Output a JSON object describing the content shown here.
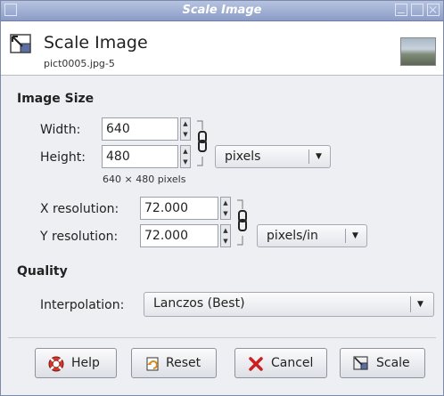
{
  "window": {
    "title": "Scale Image"
  },
  "header": {
    "title": "Scale Image",
    "subtitle": "pict0005.jpg-5"
  },
  "image_size": {
    "section_label": "Image Size",
    "width_label": "Width:",
    "width_value": "640",
    "height_label": "Height:",
    "height_value": "480",
    "size_units": "pixels",
    "size_summary": "640 × 480 pixels",
    "xres_label": "X resolution:",
    "xres_value": "72.000",
    "yres_label": "Y resolution:",
    "yres_value": "72.000",
    "res_units": "pixels/in"
  },
  "quality": {
    "section_label": "Quality",
    "interpolation_label": "Interpolation:",
    "interpolation_value": "Lanczos (Best)"
  },
  "buttons": {
    "help": "Help",
    "reset": "Reset",
    "cancel": "Cancel",
    "scale": "Scale"
  },
  "icons": {
    "scale": "scale-image-icon",
    "help": "lifebuoy-icon",
    "reset": "reset-icon",
    "cancel": "red-x-icon",
    "chain": "chain-link-icon"
  },
  "colors": {
    "titlebar": "#8c9cc6",
    "help_red": "#d8352a",
    "cancel_red": "#cc1f1f",
    "reset_orange": "#d88b1c"
  }
}
